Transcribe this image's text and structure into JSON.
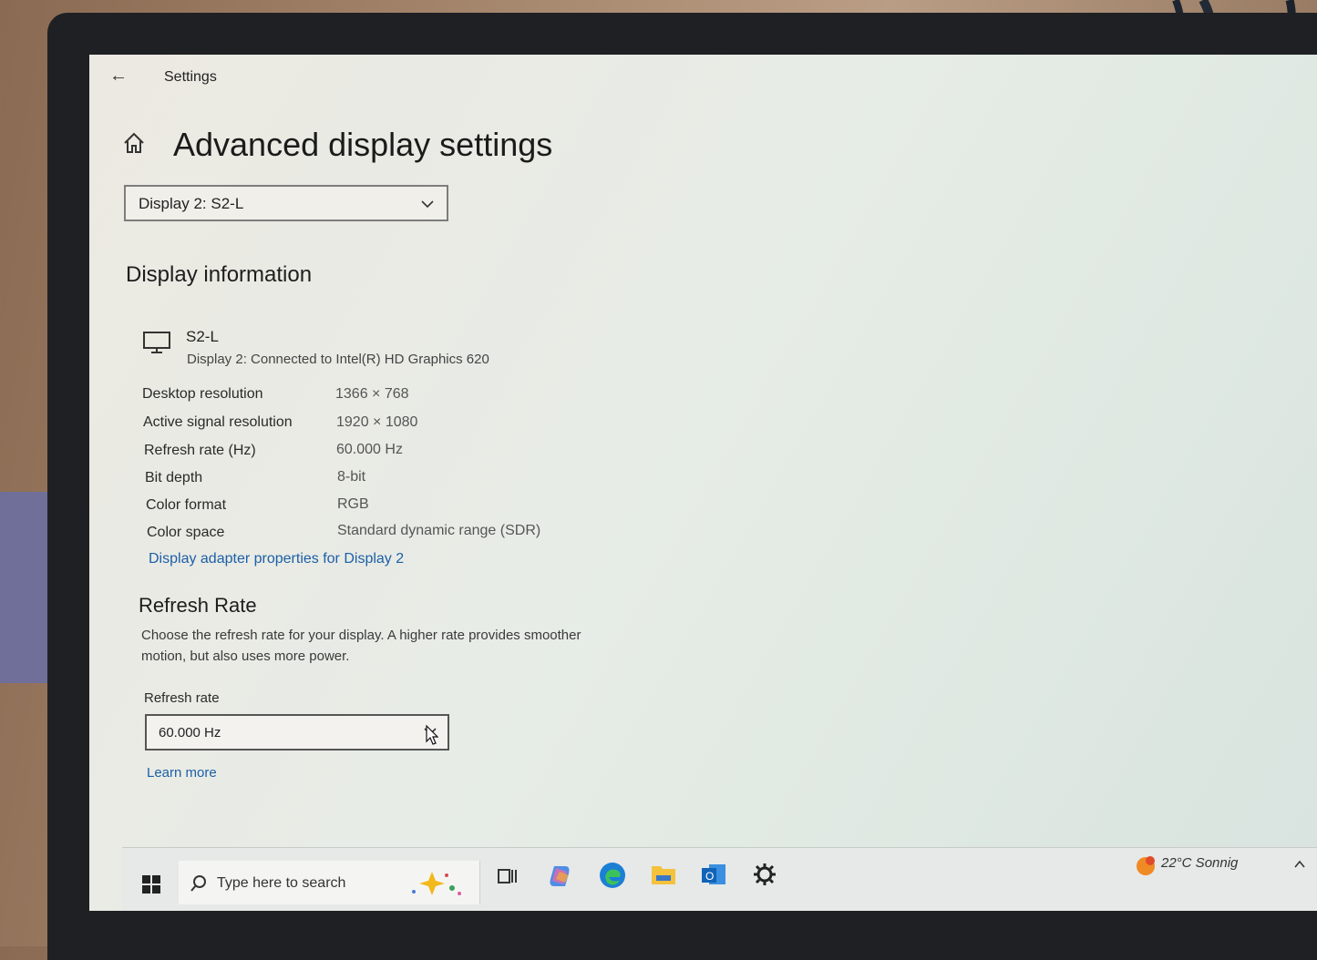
{
  "window": {
    "app_title": "Settings",
    "page_title": "Advanced display settings"
  },
  "display_select": {
    "value": "Display 2: S2-L"
  },
  "display_info": {
    "section_title": "Display information",
    "monitor_name": "S2-L",
    "monitor_desc": "Display 2: Connected to Intel(R) HD Graphics 620",
    "rows": [
      {
        "label": "Desktop resolution",
        "value": "1366 × 768"
      },
      {
        "label": "Active signal resolution",
        "value": "1920 × 1080"
      },
      {
        "label": "Refresh rate (Hz)",
        "value": "60.000 Hz"
      },
      {
        "label": "Bit depth",
        "value": "8-bit"
      },
      {
        "label": "Color format",
        "value": "RGB"
      },
      {
        "label": "Color space",
        "value": "Standard dynamic range (SDR)"
      }
    ],
    "adapter_link": "Display adapter properties for Display 2"
  },
  "refresh": {
    "title": "Refresh Rate",
    "description": "Choose the refresh rate for your display. A higher rate provides smoother motion, but also uses more power.",
    "label": "Refresh rate",
    "value": "60.000 Hz",
    "learn_more": "Learn more"
  },
  "taskbar": {
    "search_placeholder": "Type here to search",
    "weather": "22°C  Sonnig",
    "icons": [
      "windows-start-icon",
      "search-icon",
      "copilot-sparkle-icon",
      "task-view-icon",
      "copilot-app-icon",
      "edge-icon",
      "file-explorer-icon",
      "outlook-icon",
      "settings-gear-icon",
      "weather-sun-icon",
      "chevron-up-icon"
    ]
  },
  "colors": {
    "link": "#1c5fa8",
    "text": "#1b1b1b",
    "accent_edge": "#1c7fd6"
  }
}
